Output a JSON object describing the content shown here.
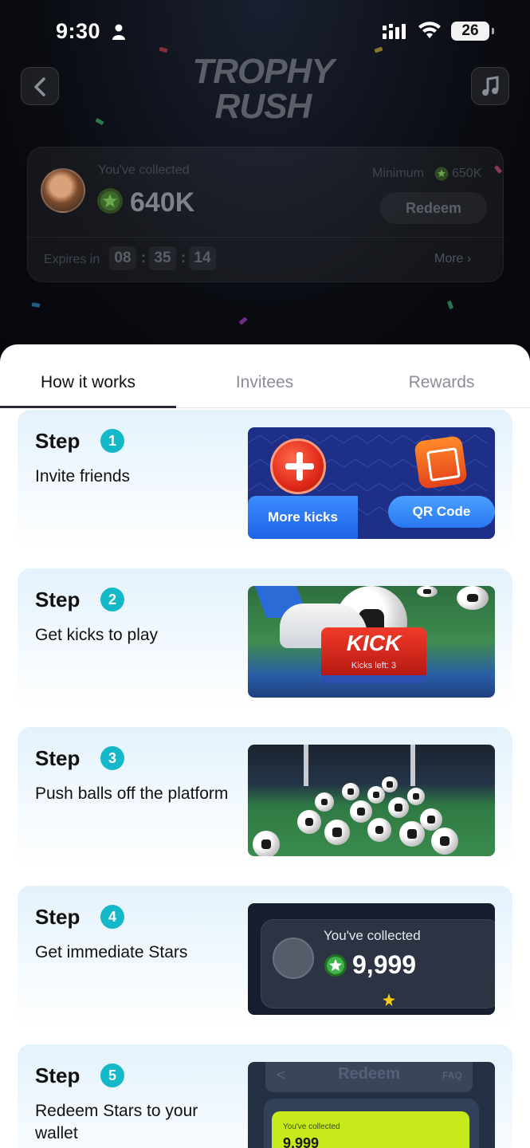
{
  "status_bar": {
    "time": "9:30",
    "battery": "26"
  },
  "header": {
    "logo_line1": "TROPHY",
    "logo_line2": "RUSH"
  },
  "collect_card": {
    "label": "You've collected",
    "amount": "640K",
    "minimum_label": "Minimum",
    "minimum_value": "650K",
    "redeem_label": "Redeem",
    "expires_label": "Expires in",
    "timer": [
      "08",
      "35",
      "14"
    ],
    "more_label": "More ›"
  },
  "tabs": [
    {
      "label": "How it works",
      "active": true
    },
    {
      "label": "Invitees",
      "active": false
    },
    {
      "label": "Rewards",
      "active": false
    }
  ],
  "steps": [
    {
      "title": "Step",
      "number": "1",
      "description": "Invite friends",
      "image": {
        "button_left": "More kicks",
        "button_right": "QR Code"
      }
    },
    {
      "title": "Step",
      "number": "2",
      "description": "Get kicks to play",
      "image": {
        "kick_label": "KICK",
        "kicks_left": "Kicks left: 3"
      }
    },
    {
      "title": "Step",
      "number": "3",
      "description": "Push balls off the platform"
    },
    {
      "title": "Step",
      "number": "4",
      "description": "Get immediate Stars",
      "image": {
        "label": "You've collected",
        "value": "9,999"
      }
    },
    {
      "title": "Step",
      "number": "5",
      "description": "Redeem Stars to your wallet",
      "image": {
        "title": "Redeem",
        "faq": "FAQ",
        "label": "You've collected",
        "value": "9,999"
      }
    }
  ],
  "colors": {
    "accent_teal": "#14b8c8",
    "star_green": "#3fb34a",
    "kick_red": "#e02a1a",
    "redeem_lime": "#c6ea1a"
  }
}
